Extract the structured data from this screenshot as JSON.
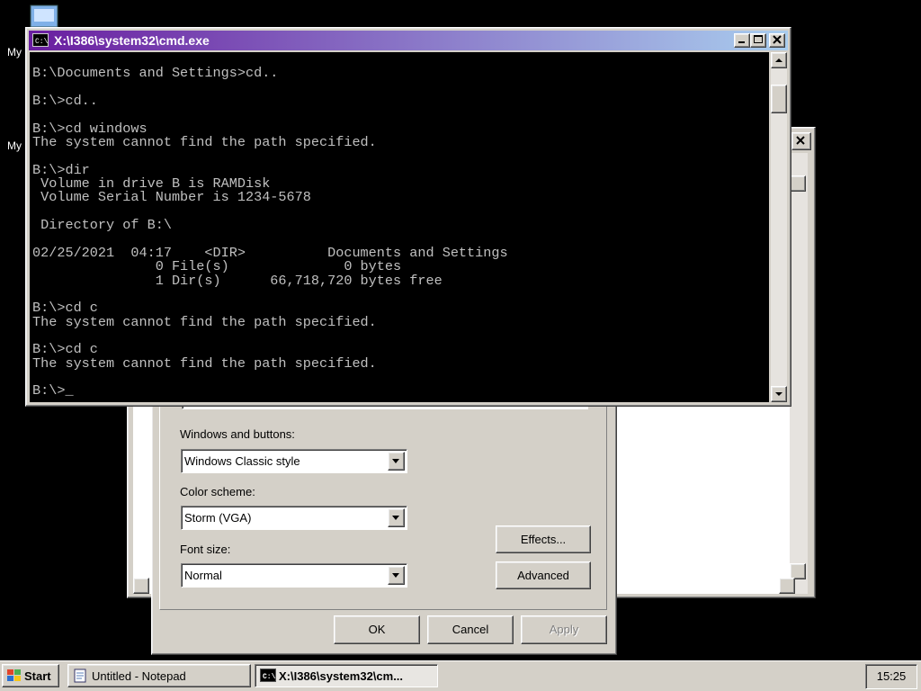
{
  "desktop": {
    "icons": [
      {
        "label": "My"
      },
      {
        "label": "My"
      }
    ]
  },
  "cmd": {
    "title": "X:\\I386\\system32\\cmd.exe",
    "console_lines": [
      "",
      "B:\\Documents and Settings>cd..",
      "",
      "B:\\>cd..",
      "",
      "B:\\>cd windows",
      "The system cannot find the path specified.",
      "",
      "B:\\>dir",
      " Volume in drive B is RAMDisk",
      " Volume Serial Number is 1234-5678",
      "",
      " Directory of B:\\",
      "",
      "02/25/2021  04:17    <DIR>          Documents and Settings",
      "               0 File(s)              0 bytes",
      "               1 Dir(s)      66,718,720 bytes free",
      "",
      "B:\\>cd c",
      "The system cannot find the path specified.",
      "",
      "B:\\>cd c",
      "The system cannot find the path specified.",
      "",
      "B:\\>_"
    ]
  },
  "display_dialog": {
    "windows_buttons_label": "Windows and buttons:",
    "windows_buttons_value": "Windows Classic style",
    "color_scheme_label": "Color scheme:",
    "color_scheme_value": "Storm (VGA)",
    "font_size_label": "Font size:",
    "font_size_value": "Normal",
    "effects_button": "Effects...",
    "advanced_button": "Advanced",
    "ok_button": "OK",
    "cancel_button": "Cancel",
    "apply_button": "Apply"
  },
  "taskbar": {
    "start_label": "Start",
    "tasks": [
      {
        "label": "Untitled - Notepad",
        "icon": "notepad-icon"
      },
      {
        "label": "X:\\I386\\system32\\cm...",
        "icon": "cmd-icon"
      }
    ],
    "clock": "15:25"
  },
  "colors": {
    "title_gradient_start": "#6a1ea0",
    "title_gradient_end": "#a9cdee",
    "face": "#d4d0c8"
  }
}
